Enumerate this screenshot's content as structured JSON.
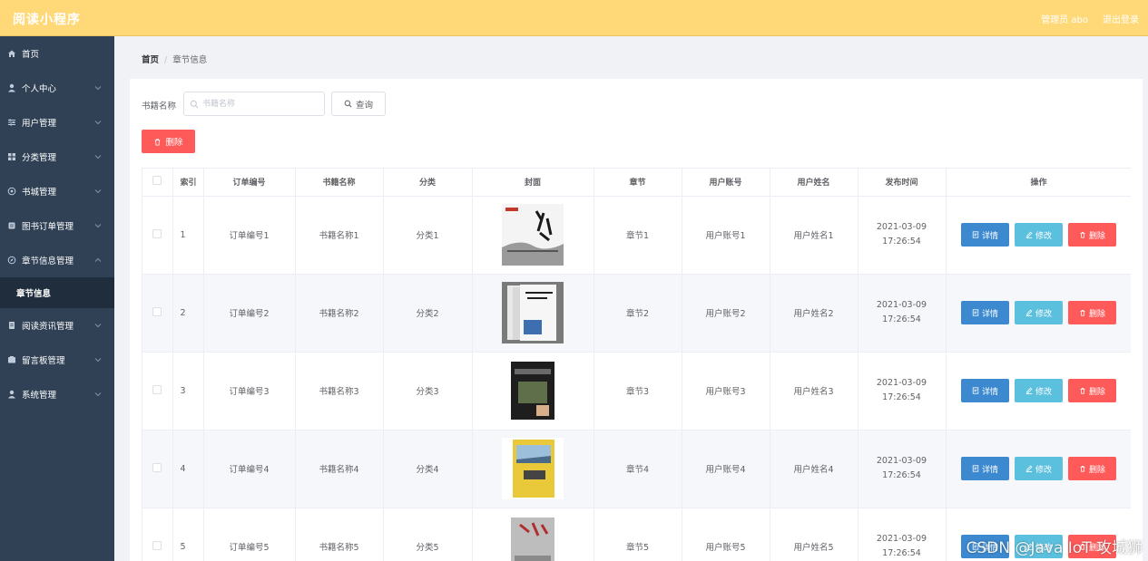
{
  "app": {
    "title": "阅读小程序"
  },
  "header": {
    "user": "管理员 abo",
    "logout": "退出登录"
  },
  "sidebar": {
    "items": [
      {
        "label": "首页",
        "icon": "home-icon"
      },
      {
        "label": "个人中心",
        "icon": "user-icon"
      },
      {
        "label": "用户管理",
        "icon": "sliders-icon"
      },
      {
        "label": "分类管理",
        "icon": "grid-icon"
      },
      {
        "label": "书城管理",
        "icon": "globe-icon"
      },
      {
        "label": "图书订单管理",
        "icon": "book-icon"
      },
      {
        "label": "章节信息管理",
        "icon": "compass-icon"
      },
      {
        "label": "章节信息",
        "icon": ""
      },
      {
        "label": "阅读资讯管理",
        "icon": "doc-icon"
      },
      {
        "label": "留言板管理",
        "icon": "board-icon"
      },
      {
        "label": "系统管理",
        "icon": "user-icon"
      }
    ]
  },
  "breadcrumb": {
    "home": "首页",
    "sep": "/",
    "current": "章节信息"
  },
  "search": {
    "label": "书籍名称",
    "placeholder": "书籍名称",
    "button": "查询"
  },
  "toolbar": {
    "delete": "删除"
  },
  "table": {
    "columns": [
      "索引",
      "订单编号",
      "书籍名称",
      "分类",
      "封面",
      "章节",
      "用户账号",
      "用户姓名",
      "发布时间",
      "操作"
    ],
    "rows": [
      {
        "index": "1",
        "order": "订单编号1",
        "book": "书籍名称1",
        "category": "分类1",
        "chapter": "章节1",
        "account": "用户账号1",
        "name": "用户姓名1",
        "time": "2021-03-09 17:26:54"
      },
      {
        "index": "2",
        "order": "订单编号2",
        "book": "书籍名称2",
        "category": "分类2",
        "chapter": "章节2",
        "account": "用户账号2",
        "name": "用户姓名2",
        "time": "2021-03-09 17:26:54"
      },
      {
        "index": "3",
        "order": "订单编号3",
        "book": "书籍名称3",
        "category": "分类3",
        "chapter": "章节3",
        "account": "用户账号3",
        "name": "用户姓名3",
        "time": "2021-03-09 17:26:54"
      },
      {
        "index": "4",
        "order": "订单编号4",
        "book": "书籍名称4",
        "category": "分类4",
        "chapter": "章节4",
        "account": "用户账号4",
        "name": "用户姓名4",
        "time": "2021-03-09 17:26:54"
      },
      {
        "index": "5",
        "order": "订单编号5",
        "book": "书籍名称5",
        "category": "分类5",
        "chapter": "章节5",
        "account": "用户账号5",
        "name": "用户姓名5",
        "time": "2021-03-09 17:26:54"
      }
    ],
    "actions": {
      "detail": "详情",
      "edit": "修改",
      "delete": "删除"
    }
  },
  "watermark": "CSDN @Java IoT 攻城狮",
  "colors": {
    "header": "#ffd878",
    "sidebar": "#304156",
    "detail": "#3c89cf",
    "edit": "#5bc0de",
    "danger": "#ff5a5a"
  }
}
